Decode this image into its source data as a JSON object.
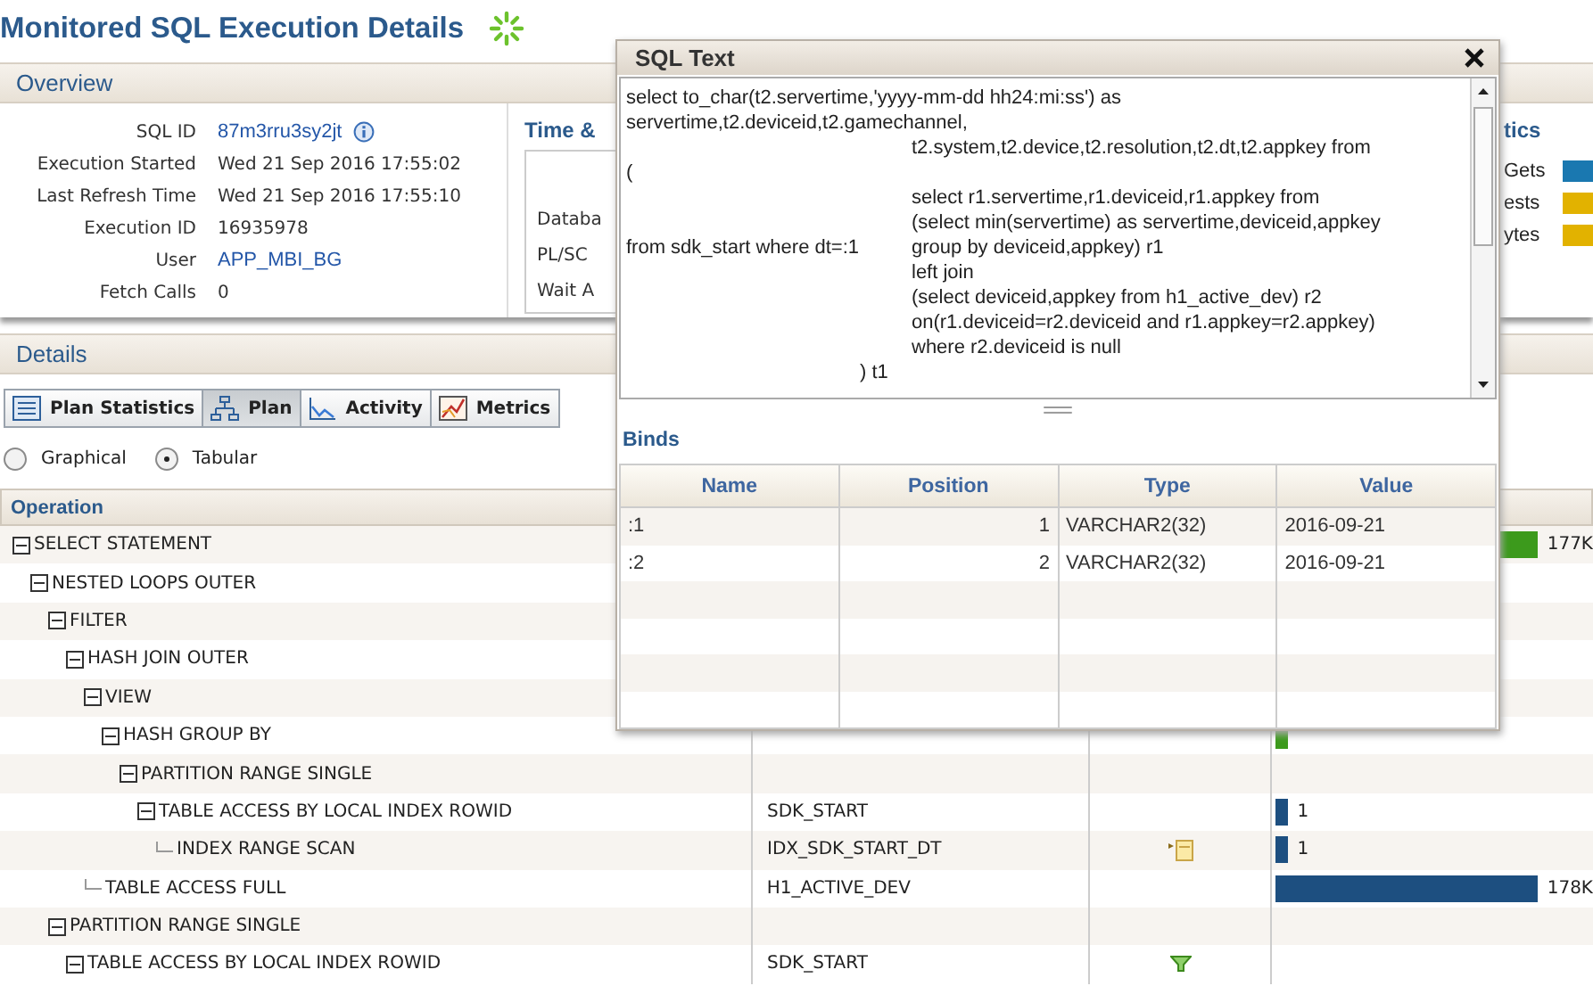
{
  "page": {
    "title": "Monitored SQL Execution Details"
  },
  "overview": {
    "title": "Overview",
    "fields": [
      {
        "label": "SQL ID",
        "value": "87m3rru3sy2jt",
        "kind": "link_info"
      },
      {
        "label": "Execution Started",
        "value": "Wed 21 Sep 2016 17:55:02",
        "kind": "text"
      },
      {
        "label": "Last Refresh Time",
        "value": "Wed 21 Sep 2016 17:55:10",
        "kind": "text"
      },
      {
        "label": "Execution ID",
        "value": "16935978",
        "kind": "text"
      },
      {
        "label": "User",
        "value": "APP_MBI_BG",
        "kind": "link"
      },
      {
        "label": "Fetch Calls",
        "value": "0",
        "kind": "text"
      }
    ],
    "time_panel": {
      "title": "Time &",
      "rows": [
        "Databa",
        "PL/SC",
        "Wait A"
      ]
    },
    "stats_panel": {
      "title": "tics",
      "rows": [
        {
          "label": "Gets",
          "color": "#1a78b0"
        },
        {
          "label": "ests",
          "color": "#e2b200"
        },
        {
          "label": "ytes",
          "color": "#e2b200"
        }
      ]
    }
  },
  "details": {
    "title": "Details",
    "tabs": [
      {
        "label": "Plan Statistics",
        "kind": "statistics",
        "selected": false
      },
      {
        "label": "Plan",
        "kind": "plan",
        "selected": true
      },
      {
        "label": "Activity",
        "kind": "activity",
        "selected": false
      },
      {
        "label": "Metrics",
        "kind": "metrics",
        "selected": false
      }
    ],
    "view_options": [
      {
        "label": "Graphical",
        "selected": false
      },
      {
        "label": "Tabular",
        "selected": true
      }
    ],
    "plan": {
      "column": "Operation",
      "rows": [
        {
          "operation": "SELECT STATEMENT",
          "expanded": true,
          "bar": {
            "level": 0.82,
            "reading": "177K",
            "color": "#3c9a1c"
          },
          "children": [
            {
              "operation": "NESTED LOOPS OUTER",
              "expanded": true,
              "children": [
                {
                  "operation": "FILTER",
                  "expanded": true,
                  "children": [
                    {
                      "operation": "HASH JOIN OUTER",
                      "expanded": true,
                      "children": [
                        {
                          "operation": "VIEW",
                          "expanded": true,
                          "children": [
                            {
                              "operation": "HASH GROUP BY",
                              "expanded": true,
                              "bar": {
                                "level": 0.04,
                                "color": "#3c9a1c"
                              },
                              "children": [
                                {
                                  "operation": "PARTITION RANGE SINGLE",
                                  "expanded": true,
                                  "children": [
                                    {
                                      "operation": "TABLE ACCESS BY LOCAL INDEX ROWID",
                                      "object": "SDK_START",
                                      "expanded": true,
                                      "bar": {
                                        "level": 0.04,
                                        "reading": "1",
                                        "color": "#1d4f80"
                                      },
                                      "children": [
                                        {
                                          "operation": "INDEX RANGE SCAN",
                                          "object": "IDX_SDK_START_DT",
                                          "kind": "note",
                                          "bar": {
                                            "level": 0.04,
                                            "reading": "1",
                                            "color": "#1d4f80"
                                          }
                                        }
                                      ]
                                    }
                                  ]
                                }
                              ]
                            }
                          ]
                        },
                        {
                          "operation": "TABLE ACCESS FULL",
                          "object": "H1_ACTIVE_DEV",
                          "bar": {
                            "level": 0.82,
                            "reading": "178K",
                            "color": "#1d4f80"
                          }
                        }
                      ]
                    }
                  ]
                },
                {
                  "operation": "PARTITION RANGE SINGLE",
                  "expanded": true,
                  "children": [
                    {
                      "operation": "TABLE ACCESS BY LOCAL INDEX ROWID",
                      "object": "SDK_START",
                      "kind": "filter",
                      "expanded": true
                    }
                  ]
                }
              ]
            }
          ]
        }
      ]
    }
  },
  "sql_dialog": {
    "title": "SQL Text",
    "lines": [
      {
        "kind": "flush",
        "text": "select to_char(t2.servertime,'yyyy-mm-dd hh24:mi:ss') as"
      },
      {
        "kind": "flush",
        "text": "servertime,t2.deviceid,t2.gamechannel,"
      },
      {
        "kind": "tab",
        "text": "t2.system,t2.device,t2.resolution,t2.dt,t2.appkey from"
      },
      {
        "kind": "flush",
        "text": "("
      },
      {
        "kind": "tab",
        "text": "select r1.servertime,r1.deviceid,r1.appkey from"
      },
      {
        "kind": "tab",
        "text": "(select  min(servertime) as servertime,deviceid,appkey"
      },
      {
        "kind": "tab",
        "lead": "from sdk_start where dt=:1",
        "text": "group by deviceid,appkey) r1"
      },
      {
        "kind": "tab",
        "text": "left join"
      },
      {
        "kind": "tab",
        "text": "(select deviceid,appkey from h1_active_dev) r2"
      },
      {
        "kind": "tab",
        "text": "on(r1.deviceid=r2.deviceid and r1.appkey=r2.appkey)"
      },
      {
        "kind": "tab",
        "text": "where r2.deviceid is null"
      },
      {
        "kind": "close",
        "text": ") t1"
      }
    ],
    "binds_title": "Binds",
    "binds_columns": [
      "Name",
      "Position",
      "Type",
      "Value"
    ],
    "binds_rows": [
      [
        ":1",
        "1",
        "VARCHAR2(32)",
        "2016-09-21"
      ],
      [
        ":2",
        "2",
        "VARCHAR2(32)",
        "2016-09-21"
      ]
    ]
  }
}
